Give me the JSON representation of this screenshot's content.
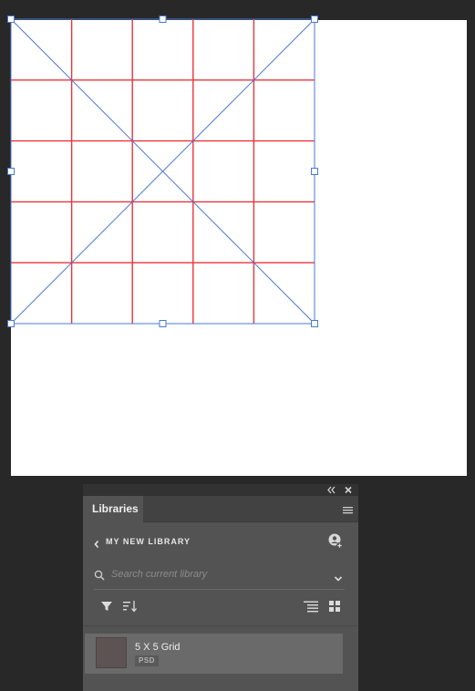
{
  "canvas": {
    "grid": {
      "rows": 5,
      "columns": 5
    },
    "colors": {
      "artboard": "#ffffff",
      "workspace": "#282828",
      "guide_red": "#e8343c",
      "selection_blue": "#4a78d2"
    }
  },
  "libraries_panel": {
    "topbar": {
      "collapse_icon": "double-chevron-left-icon",
      "close_icon": "close-icon"
    },
    "tab_label": "Libraries",
    "menu_icon": "hamburger-menu-icon",
    "library_name": "MY NEW LIBRARY",
    "search": {
      "placeholder": "Search current library",
      "value": ""
    },
    "toolbar": {
      "icons": [
        "filter-icon",
        "sort-icon",
        "list-view-icon",
        "grid-view-icon"
      ]
    },
    "assets": [
      {
        "name": "5 X 5 Grid",
        "type": "PSD"
      }
    ]
  }
}
